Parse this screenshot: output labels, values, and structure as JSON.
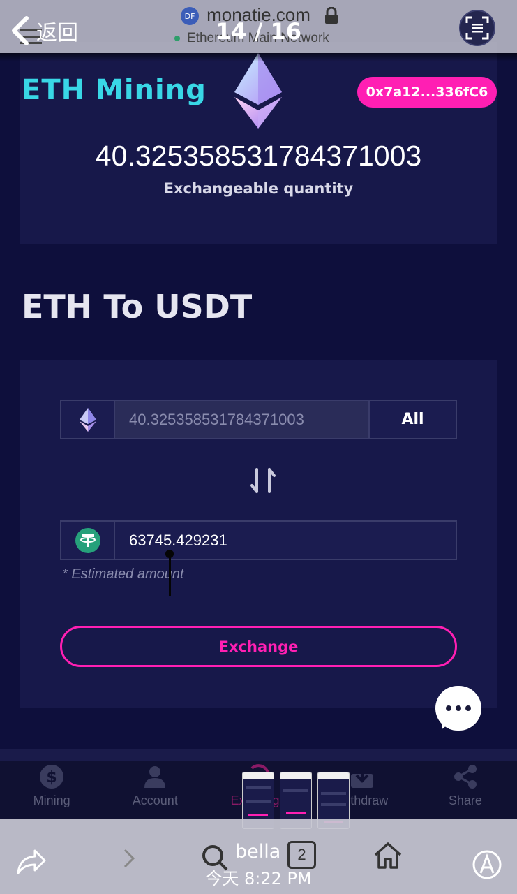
{
  "browser": {
    "back_label": "返回",
    "site_name": "monatie.com",
    "site_logo_text": "DF",
    "page_counter": "14 / 16",
    "network": "Ethereum Main Network",
    "bella": "bella",
    "tab_count": "2",
    "timestamp": "今天 8:22 PM"
  },
  "header": {
    "brand": "ETH Mining",
    "address": "0x7a12...336fC6"
  },
  "summary": {
    "quantity": "40.325358531784371003",
    "quantity_label": "Exchangeable quantity"
  },
  "exchange": {
    "title": "ETH To USDT",
    "from_value": "40.325358531784371003",
    "all_label": "All",
    "to_value": "63745.429231",
    "estimated_note": "* Estimated amount",
    "exchange_label": "Exchange"
  },
  "tabbar": {
    "items": [
      {
        "label": "Mining",
        "icon": "dollar-icon"
      },
      {
        "label": "Account",
        "icon": "user-icon"
      },
      {
        "label": "Exchange",
        "icon": "exchange-icon"
      },
      {
        "label": "Withdraw",
        "icon": "download-icon"
      },
      {
        "label": "Share",
        "icon": "share-icon"
      }
    ]
  },
  "colors": {
    "accent_pink": "#ff1fb3",
    "brand_cyan": "#39d7e6",
    "background": "#0e0f3c",
    "card": "#17184a",
    "usdt_green": "#26a17b"
  }
}
